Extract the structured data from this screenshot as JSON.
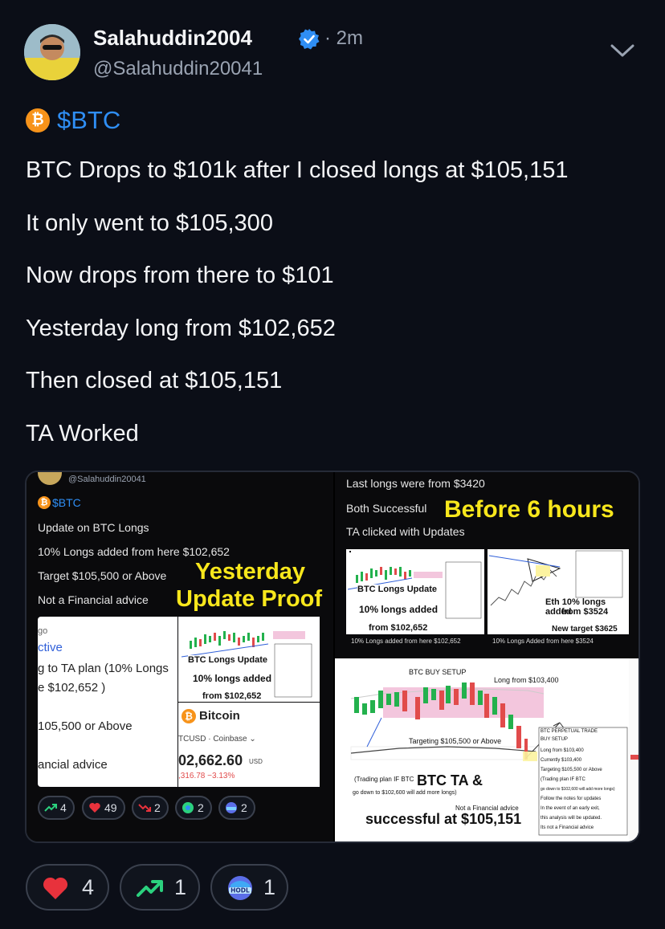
{
  "author": {
    "username": "Salahuddin2004",
    "handle": "@Salahuddin20041",
    "time_ago": "· 2m",
    "verified": true
  },
  "post": {
    "ticker": "$BTC",
    "lines": [
      "BTC Drops to $101k after I closed longs at $105,151",
      "It only went to $105,300",
      "Now drops from there to $101",
      "Yesterday long from $102,652",
      "Then closed at $105,151",
      "TA Worked"
    ]
  },
  "media": {
    "left": {
      "handle": "@Salahuddin20041",
      "ticker": "$BTC",
      "lines": [
        "Update on BTC Longs",
        "10% Longs added from here $102,652",
        "Target $105,500 or Above",
        "Not a Financial advice"
      ],
      "overlay_1": "Yesterday",
      "overlay_2": "Update Proof",
      "card_left_lines": [
        "go",
        "ctive",
        "g to TA plan (10% Longs",
        "e $102,652 )",
        "105,500 or Above",
        "ancial advice"
      ],
      "chart_title": "BTC Longs Update",
      "chart_sub": "10% longs added",
      "chart_from": "from $102,652",
      "coin_name": "Bitcoin",
      "coin_pair": "TCUSD · Coinbase ⌄",
      "coin_price": "02,662.60",
      "coin_unit": "USD",
      "coin_change": ",316.78 −3.13%",
      "mini_reactions": [
        {
          "icon": "trend-up-icon",
          "count": "4"
        },
        {
          "icon": "heart-icon",
          "count": "49"
        },
        {
          "icon": "trend-down-icon",
          "count": "2"
        },
        {
          "icon": "rocket-icon",
          "count": "2"
        },
        {
          "icon": "hodl-icon",
          "count": "2"
        }
      ]
    },
    "right_top": {
      "line_1": "Last longs were from $3420",
      "line_2": "Both Successful",
      "line_3": "TA clicked with Updates",
      "overlay": "Before 6 hours",
      "thumb_left_title": "BTC Longs Update",
      "thumb_left_sub": "10% longs added",
      "thumb_left_from": "from $102,652",
      "thumb_left_caption": "10% Longs added from here $102,652",
      "thumb_right_title": "Eth 10% longs added",
      "thumb_right_sub": "from $3524",
      "thumb_right_target": "New target $3625",
      "thumb_right_caption": "10% Longs Added from here $3524"
    },
    "right_bottom": {
      "setup_label": "BTC BUY SETUP",
      "long_label": "Long from $103,400",
      "target_label": "Targeting $105,500 or Above",
      "plan_label": "(Trading plan IF BTC",
      "plan_label_2": "go down to $102,600 will add more longs)",
      "ta_title": "BTC TA &",
      "success": "successful at $105,151",
      "nfa": "Not a Financial advice",
      "notes": [
        "BTC PERPETUAL TRADE",
        "BUY SETUP",
        "Long from $103,400",
        "Currently $103,400",
        "Targeting $105,500 or Above",
        "(Trading plan IF BTC",
        "go down to $102,600 will add more longs)",
        "Follow the notes for updates",
        "In the event of an early exit,",
        "this analysis will be updated.",
        "Its not a Financial advice"
      ]
    }
  },
  "reactions": [
    {
      "icon": "heart-icon",
      "count": "4"
    },
    {
      "icon": "trend-up-icon",
      "count": "1"
    },
    {
      "icon": "hodl-icon",
      "count": "1"
    }
  ],
  "colors": {
    "background": "#0b0e17",
    "accent_blue": "#2f8ef4",
    "btc_orange": "#f7931a",
    "overlay_yellow": "#f8e71c",
    "heart_red": "#e8323c",
    "trend_green": "#2bd17e"
  }
}
